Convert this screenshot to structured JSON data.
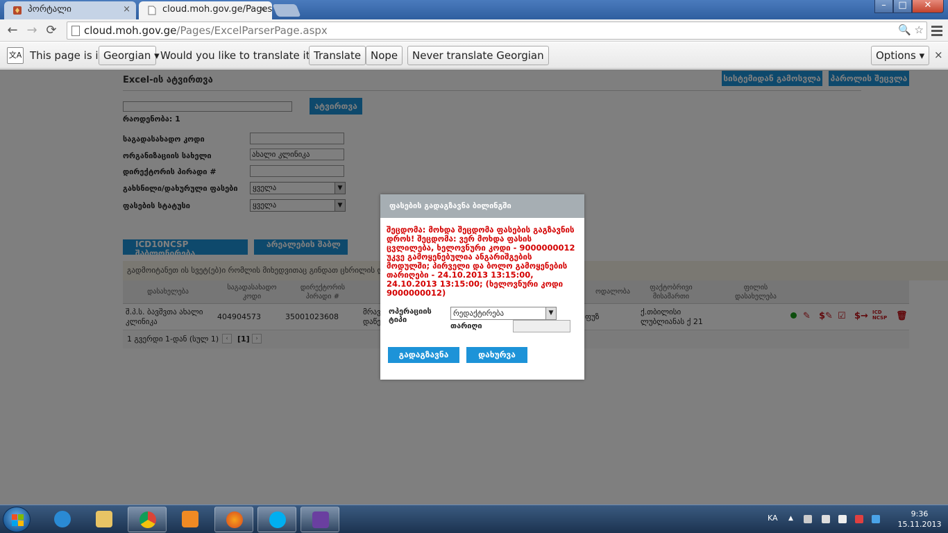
{
  "browser": {
    "tabs": [
      {
        "title": "პორტალი",
        "close": "×"
      },
      {
        "title": "cloud.moh.gov.ge/Pages/",
        "close": "×"
      }
    ],
    "window_controls": {
      "minimize": "–",
      "maximize": "□",
      "close": "✕"
    },
    "address": {
      "host": "cloud.moh.gov.ge",
      "path": "/Pages/ExcelParserPage.aspx"
    }
  },
  "translate_bar": {
    "prefix": "This page is in",
    "language": "Georgian",
    "question": "Would you like to translate it?",
    "translate": "Translate",
    "nope": "Nope",
    "never": "Never translate Georgian",
    "options": "Options",
    "close": "×"
  },
  "page": {
    "title": "Excel-ის ატვირთვა",
    "logout": "სისტემიდან გამოსვლა",
    "change_password": "პაროლის შეცვლა",
    "upload_button": "ატვირთვა",
    "count_label": "რაოდენობა: 1",
    "filters": [
      {
        "label": "საგადასახადო კოდი",
        "value": ""
      },
      {
        "label": "ორგანიზაციის სახელი",
        "value": "ახალი კლინიკა"
      },
      {
        "label": "დირექტორის პირადი #",
        "value": ""
      },
      {
        "label": "გახსნილი/დახურული ფასები",
        "value": "ყველა"
      },
      {
        "label": "ფასების სტატუსი",
        "value": "ყველა"
      }
    ],
    "tab_icd": "ICD10NCSP შაბლონირება",
    "tab_regions": "არეალების შაბლ",
    "info_text": "გადმოიტანეთ ის სვეტ(ებ)ი რომლის მიხედვითაც გინდათ ცხრილის დაჯგუფება",
    "columns": [
      "დასახელება",
      "საგადასახადო კოდი",
      "დირექტორის პირადი #",
      "ოდალობა",
      "ფაქტობრივი მისამართი",
      "ფილის დასახელება"
    ],
    "row": {
      "name": "შ.პ.ს. ბავშვთა ახალი კლინიკა",
      "tax_code": "404904573",
      "director_id": "35001023608",
      "col4": "მრავ დაწე",
      "col5": "ფუზ",
      "address": "ქ.თბილისი ლუბლიანას ქ 21"
    },
    "pager": {
      "text": "1 გვერდი 1-დან (სულ 1)",
      "current": "[1]"
    }
  },
  "modal": {
    "title": "ფასების გადაგზავნა ბილინგში",
    "error": "შეცდომა: მოხდა შეცდომა ფასების გაგზავნის დროს! შეცდომა: ვერ მოხდა ფასის ცვლილება, ხელოვნური კოდი - 9000000012 უკვე გამოყენებულია ანგარიშგების მოდულში; პირველი და ბოლო გამოყენების თარიღები - 24.10.2013 13:15:00, 24.10.2013 13:15:00; (ხელოვნური კოდი 9000000012)",
    "op_label": "ოპერაციის ტიპი",
    "op_value": "რედაქტირება",
    "date_label": "თარიღი",
    "send": "გადაგზავნა",
    "close": "დახურვა"
  },
  "taskbar": {
    "lang": "KA",
    "time": "9:36",
    "date": "15.11.2013"
  },
  "colors": {
    "accent": "#1d93d8",
    "error": "#d40000",
    "modal_header": "#a6aeb3"
  }
}
